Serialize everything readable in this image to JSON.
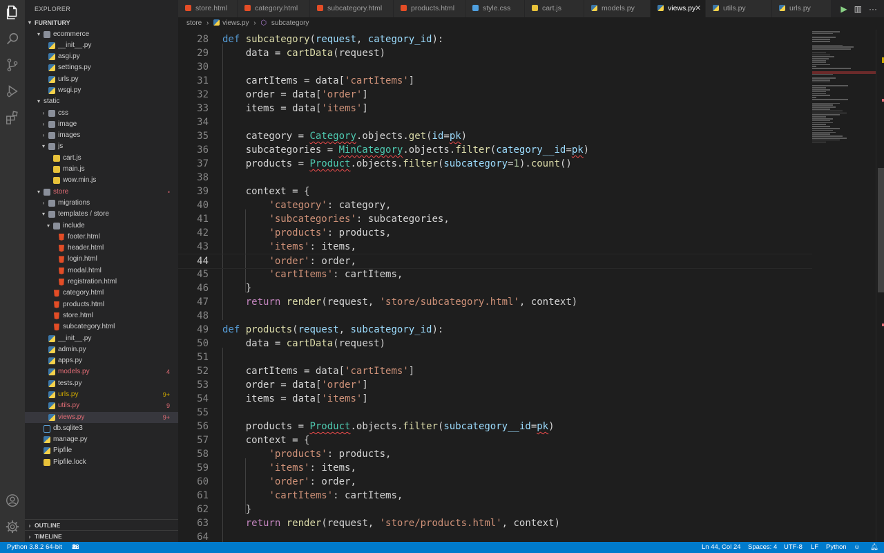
{
  "explorer": {
    "title": "EXPLORER",
    "root": "FURNITURY",
    "tree": [
      {
        "label": "ecommerce",
        "type": "folder",
        "depth": 1,
        "open": true
      },
      {
        "label": "__init__.py",
        "type": "py",
        "depth": 2
      },
      {
        "label": "asgi.py",
        "type": "py",
        "depth": 2
      },
      {
        "label": "settings.py",
        "type": "py",
        "depth": 2
      },
      {
        "label": "urls.py",
        "type": "py",
        "depth": 2
      },
      {
        "label": "wsgi.py",
        "type": "py",
        "depth": 2
      },
      {
        "label": "static",
        "type": "folder-plain",
        "depth": 1,
        "open": true
      },
      {
        "label": "css",
        "type": "folder",
        "depth": 2,
        "open": false
      },
      {
        "label": "image",
        "type": "folder",
        "depth": 2,
        "open": false
      },
      {
        "label": "images",
        "type": "folder",
        "depth": 2,
        "open": false
      },
      {
        "label": "js",
        "type": "folder",
        "depth": 2,
        "open": true
      },
      {
        "label": "cart.js",
        "type": "js",
        "depth": 3
      },
      {
        "label": "main.js",
        "type": "js",
        "depth": 3
      },
      {
        "label": "wow.min.js",
        "type": "js",
        "depth": 3
      },
      {
        "label": "store",
        "type": "folder",
        "depth": 1,
        "open": true,
        "color": "#e06c75",
        "badge": "•",
        "badgeColor": "#b4565f"
      },
      {
        "label": "migrations",
        "type": "folder",
        "depth": 2,
        "open": false
      },
      {
        "label": "templates / store",
        "type": "folder",
        "depth": 2,
        "open": true
      },
      {
        "label": "include",
        "type": "folder",
        "depth": 3,
        "open": true
      },
      {
        "label": "footer.html",
        "type": "html",
        "depth": 4
      },
      {
        "label": "header.html",
        "type": "html",
        "depth": 4
      },
      {
        "label": "login.html",
        "type": "html",
        "depth": 4
      },
      {
        "label": "modal.html",
        "type": "html",
        "depth": 4
      },
      {
        "label": "registration.html",
        "type": "html",
        "depth": 4
      },
      {
        "label": "category.html",
        "type": "html",
        "depth": 3
      },
      {
        "label": "products.html",
        "type": "html",
        "depth": 3
      },
      {
        "label": "store.html",
        "type": "html",
        "depth": 3
      },
      {
        "label": "subcategory.html",
        "type": "html",
        "depth": 3
      },
      {
        "label": "__init__.py",
        "type": "py",
        "depth": 2
      },
      {
        "label": "admin.py",
        "type": "py",
        "depth": 2
      },
      {
        "label": "apps.py",
        "type": "py",
        "depth": 2
      },
      {
        "label": "models.py",
        "type": "py",
        "depth": 2,
        "color": "#e06c75",
        "badge": "4",
        "badgeColor": "#e06c75"
      },
      {
        "label": "tests.py",
        "type": "py",
        "depth": 2
      },
      {
        "label": "urls.py",
        "type": "py",
        "depth": 2,
        "color": "#cca700",
        "badge": "9+",
        "badgeColor": "#cca700"
      },
      {
        "label": "utils.py",
        "type": "py",
        "depth": 2,
        "color": "#e06c75",
        "badge": "9",
        "badgeColor": "#e06c75"
      },
      {
        "label": "views.py",
        "type": "py",
        "depth": 2,
        "color": "#e06c75",
        "badge": "9+",
        "badgeColor": "#e06c75",
        "selected": true
      },
      {
        "label": "db.sqlite3",
        "type": "db",
        "depth": 1
      },
      {
        "label": "manage.py",
        "type": "py",
        "depth": 1
      },
      {
        "label": "Pipfile",
        "type": "pip",
        "depth": 1
      },
      {
        "label": "Pipfile.lock",
        "type": "lock",
        "depth": 1
      }
    ],
    "outline": "OUTLINE",
    "timeline": "TIMELINE"
  },
  "tabs": [
    {
      "label": "store.html",
      "icon": "html"
    },
    {
      "label": "category.html",
      "icon": "html"
    },
    {
      "label": "subcategory.html",
      "icon": "html"
    },
    {
      "label": "products.html",
      "icon": "html"
    },
    {
      "label": "style.css",
      "icon": "css"
    },
    {
      "label": "cart.js",
      "icon": "js"
    },
    {
      "label": "models.py",
      "icon": "py"
    },
    {
      "label": "views.py",
      "icon": "py",
      "active": true
    },
    {
      "label": "utils.py",
      "icon": "py"
    },
    {
      "label": "urls.py",
      "icon": "py"
    }
  ],
  "breadcrumb": {
    "folder": "store",
    "file": "views.py",
    "symbol": "subcategory"
  },
  "code_lines": [
    {
      "n": "28",
      "code": "def subcategory(request, category_id):"
    },
    {
      "n": "29",
      "code": "    data = cartData(request)"
    },
    {
      "n": "30",
      "code": ""
    },
    {
      "n": "31",
      "code": "    cartItems = data['cartItems']"
    },
    {
      "n": "32",
      "code": "    order = data['order']"
    },
    {
      "n": "33",
      "code": "    items = data['items']"
    },
    {
      "n": "34",
      "code": ""
    },
    {
      "n": "35",
      "code": "    category = Category.objects.get(id=pk)"
    },
    {
      "n": "36",
      "code": "    subcategories = MinCategory.objects.filter(category__id=pk)"
    },
    {
      "n": "37",
      "code": "    products = Product.objects.filter(subcategory=1).count()"
    },
    {
      "n": "38",
      "code": ""
    },
    {
      "n": "39",
      "code": "    context = {"
    },
    {
      "n": "40",
      "code": "        'category': category,"
    },
    {
      "n": "41",
      "code": "        'subcategories': subcategories,"
    },
    {
      "n": "42",
      "code": "        'products': products,"
    },
    {
      "n": "43",
      "code": "        'items': items,"
    },
    {
      "n": "44",
      "code": "        'order': order,"
    },
    {
      "n": "45",
      "code": "        'cartItems': cartItems,"
    },
    {
      "n": "46",
      "code": "    }"
    },
    {
      "n": "47",
      "code": "    return render(request, 'store/subcategory.html', context)"
    },
    {
      "n": "48",
      "code": ""
    },
    {
      "n": "49",
      "code": "def products(request, subcategory_id):"
    },
    {
      "n": "50",
      "code": "    data = cartData(request)"
    },
    {
      "n": "51",
      "code": ""
    },
    {
      "n": "52",
      "code": "    cartItems = data['cartItems']"
    },
    {
      "n": "53",
      "code": "    order = data['order']"
    },
    {
      "n": "54",
      "code": "    items = data['items']"
    },
    {
      "n": "55",
      "code": ""
    },
    {
      "n": "56",
      "code": "    products = Product.objects.filter(subcategory__id=pk)"
    },
    {
      "n": "57",
      "code": "    context = {"
    },
    {
      "n": "58",
      "code": "        'products': products,"
    },
    {
      "n": "59",
      "code": "        'items': items,"
    },
    {
      "n": "60",
      "code": "        'order': order,"
    },
    {
      "n": "61",
      "code": "        'cartItems': cartItems,"
    },
    {
      "n": "62",
      "code": "    }"
    },
    {
      "n": "63",
      "code": "    return render(request, 'store/products.html', context)"
    },
    {
      "n": "64",
      "code": ""
    }
  ],
  "status": {
    "interpreter": "Python 3.8.2 64-bit",
    "errors": "16",
    "warnings": "32",
    "position": "Ln 44, Col 24",
    "spaces": "Spaces: 4",
    "encoding": "UTF-8",
    "eol": "LF",
    "language": "Python"
  },
  "colors": {
    "accent": "#007acc",
    "error": "#e06c75",
    "warning": "#cca700"
  }
}
